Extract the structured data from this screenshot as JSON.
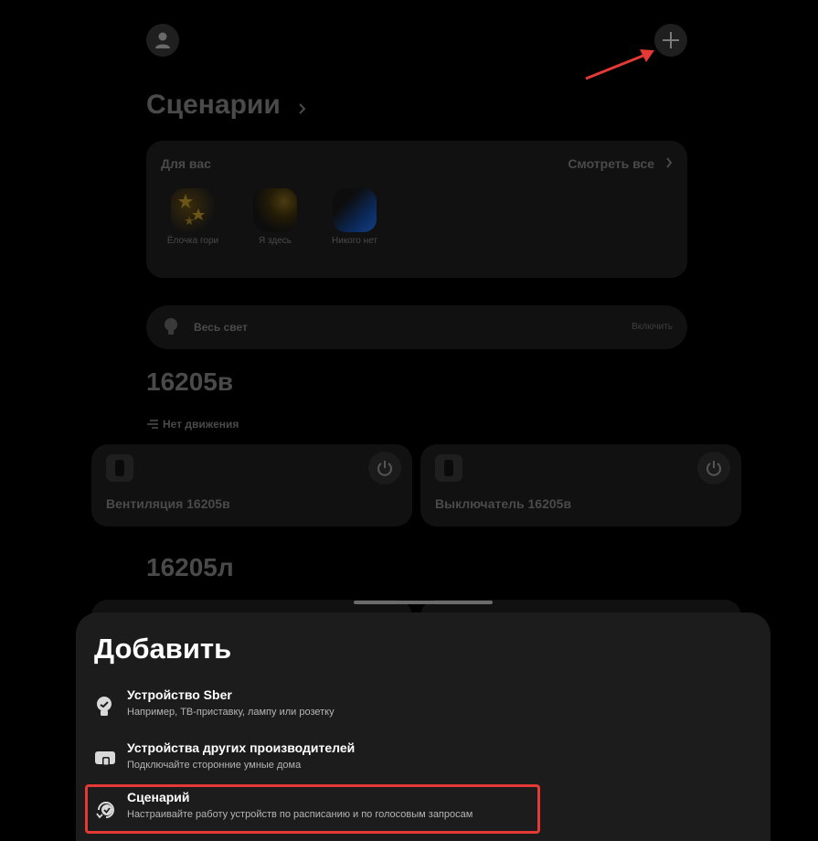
{
  "header": {
    "profile_icon": "user-icon",
    "add_icon": "plus-icon",
    "annotation_color": "#e53935"
  },
  "scenarios": {
    "title": "Сценарии",
    "for_you_label": "Для вас",
    "see_all": "Смотреть все",
    "items": [
      {
        "name": "Ёлочка гори",
        "color": "#d4a62a"
      },
      {
        "name": "Я здесь",
        "color": "#b8952a"
      },
      {
        "name": "Никого нет",
        "color": "#1f5fc9"
      }
    ]
  },
  "all_lights": {
    "label": "Весь свет",
    "action": "Включить"
  },
  "rooms": [
    {
      "title": "16205в",
      "status": "Нет движения",
      "devices": [
        {
          "name": "Вентиляция 16205в"
        },
        {
          "name": "Выключатель 16205в"
        }
      ]
    },
    {
      "title": "16205л"
    }
  ],
  "add_sheet": {
    "title": "Добавить",
    "options": [
      {
        "title": "Устройство Sber",
        "subtitle": "Например, ТВ-приставку, лампу или розетку",
        "icon": "lightbulb-icon"
      },
      {
        "title": "Устройства других производителей",
        "subtitle": "Подключайте сторонние умные дома",
        "icon": "devices-icon"
      },
      {
        "title": "Сценарий",
        "subtitle": "Настраивайте работу устройств по расписанию и по голосовым запросам",
        "icon": "scenario-icon"
      }
    ]
  }
}
